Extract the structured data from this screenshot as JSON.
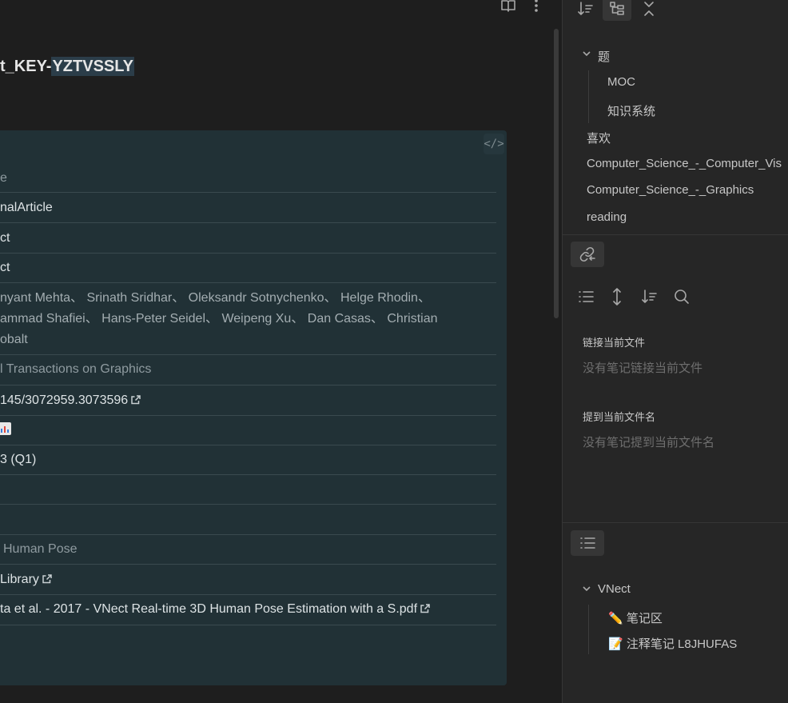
{
  "editor": {
    "title_prefix": "t_KEY-",
    "title_highlight": "YZTVSSLY",
    "code_toggle_label": "</>",
    "rows": {
      "type_label": "e",
      "item_type": "nalArticle",
      "short1": "ct",
      "short2": "ct",
      "authors": "nyant Mehta、 Srinath Sridhar、 Oleksandr Sotnychenko、 Helge Rhodin、 ammad Shafiei、 Hans-Peter Seidel、 Weipeng Xu、 Dan Casas、 Christian obalt",
      "authors_line1": "nyant Mehta、 Srinath Sridhar、 Oleksandr Sotnychenko、 Helge Rhodin、",
      "authors_line2": "ammad Shafiei、 Hans-Peter Seidel、 Weipeng Xu、 Dan Casas、 Christian",
      "authors_line3": "obalt",
      "journal": "l Transactions on Graphics",
      "doi": "145/3072959.3073596",
      "jcr": "3 (Q1)",
      "tags": "Human Pose",
      "library": "Library",
      "pdf": "ta et al. - 2017 - VNect Real-time 3D Human Pose Estimation with a S.pdf"
    }
  },
  "toolbar": {
    "reading_view_icon": "book-open-icon",
    "more_icon": "more-vertical-icon"
  },
  "right_panel": {
    "file_tree": {
      "sort_icon": "sort-icon",
      "tree_icon": "tree-icon",
      "collapse_icon": "collapse-icon",
      "folder": "题",
      "children": [
        "MOC",
        "知识系统"
      ],
      "items": [
        "喜欢",
        "Computer_Science_-_Computer_Vis",
        "Computer_Science_-_Graphics",
        "reading"
      ]
    },
    "backlinks": {
      "backlink_icon": "link-back-icon",
      "tools": [
        "list-icon",
        "expand-icon",
        "sort-icon",
        "search-icon"
      ],
      "linked_heading": "链接当前文件",
      "linked_empty": "没有笔记链接当前文件",
      "unlinked_heading": "提到当前文件名",
      "unlinked_empty": "没有笔记提到当前文件名"
    },
    "outline": {
      "outline_icon": "list-icon",
      "root": "VNect",
      "items": [
        {
          "emoji": "✏️",
          "label": "笔记区"
        },
        {
          "emoji": "📝",
          "label": "注释笔记 L8JHUFAS"
        }
      ]
    }
  }
}
